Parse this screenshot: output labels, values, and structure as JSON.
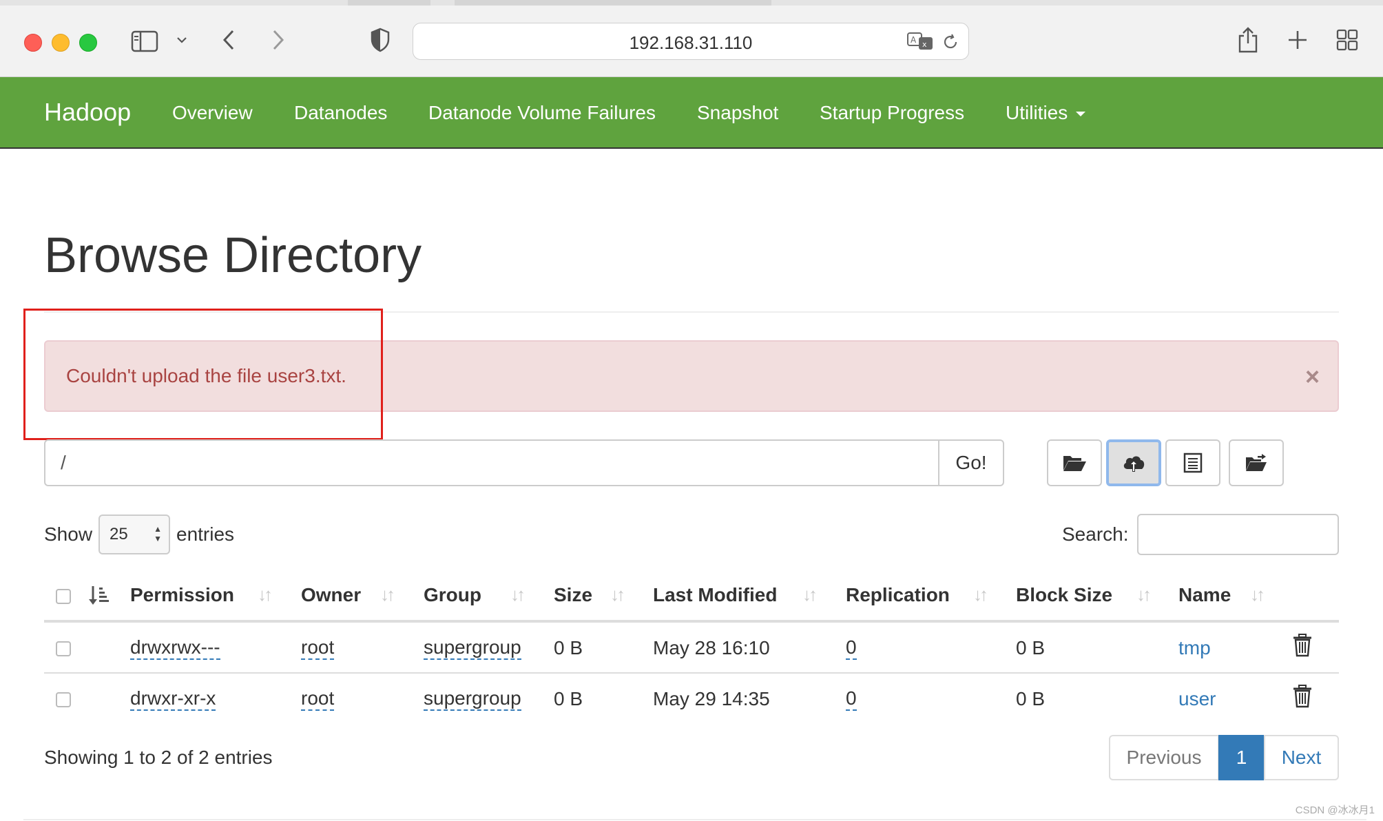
{
  "browser": {
    "url": "192.168.31.110"
  },
  "navbar": {
    "brand": "Hadoop",
    "links": [
      "Overview",
      "Datanodes",
      "Datanode Volume Failures",
      "Snapshot",
      "Startup Progress",
      "Utilities"
    ]
  },
  "page": {
    "title": "Browse Directory",
    "alert": {
      "message": "Couldn't upload the file user3.txt.",
      "close": "×"
    },
    "path": {
      "value": "/",
      "go_label": "Go!"
    },
    "toolbar_icons": [
      "folder-open-icon",
      "cloud-upload-icon",
      "list-icon",
      "folder-move-icon"
    ],
    "length": {
      "show_label": "Show",
      "value": "25",
      "entries_label": "entries"
    },
    "search": {
      "label": "Search:",
      "value": ""
    }
  },
  "table": {
    "columns": [
      "Permission",
      "Owner",
      "Group",
      "Size",
      "Last Modified",
      "Replication",
      "Block Size",
      "Name"
    ],
    "rows": [
      {
        "permission": "drwxrwx---",
        "owner": "root",
        "group": "supergroup",
        "size": "0 B",
        "modified": "May 28 16:10",
        "replication": "0",
        "block_size": "0 B",
        "name": "tmp"
      },
      {
        "permission": "drwxr-xr-x",
        "owner": "root",
        "group": "supergroup",
        "size": "0 B",
        "modified": "May 29 14:35",
        "replication": "0",
        "block_size": "0 B",
        "name": "user"
      }
    ],
    "info": "Showing 1 to 2 of 2 entries",
    "pagination": {
      "previous": "Previous",
      "current": "1",
      "next": "Next"
    }
  },
  "watermark": "CSDN @冰冰月1",
  "colors": {
    "navbar": "#5fa33e",
    "alert_bg": "#f2dede",
    "alert_text": "#a94442",
    "link": "#337ab7",
    "highlight_box": "#e0201b"
  }
}
